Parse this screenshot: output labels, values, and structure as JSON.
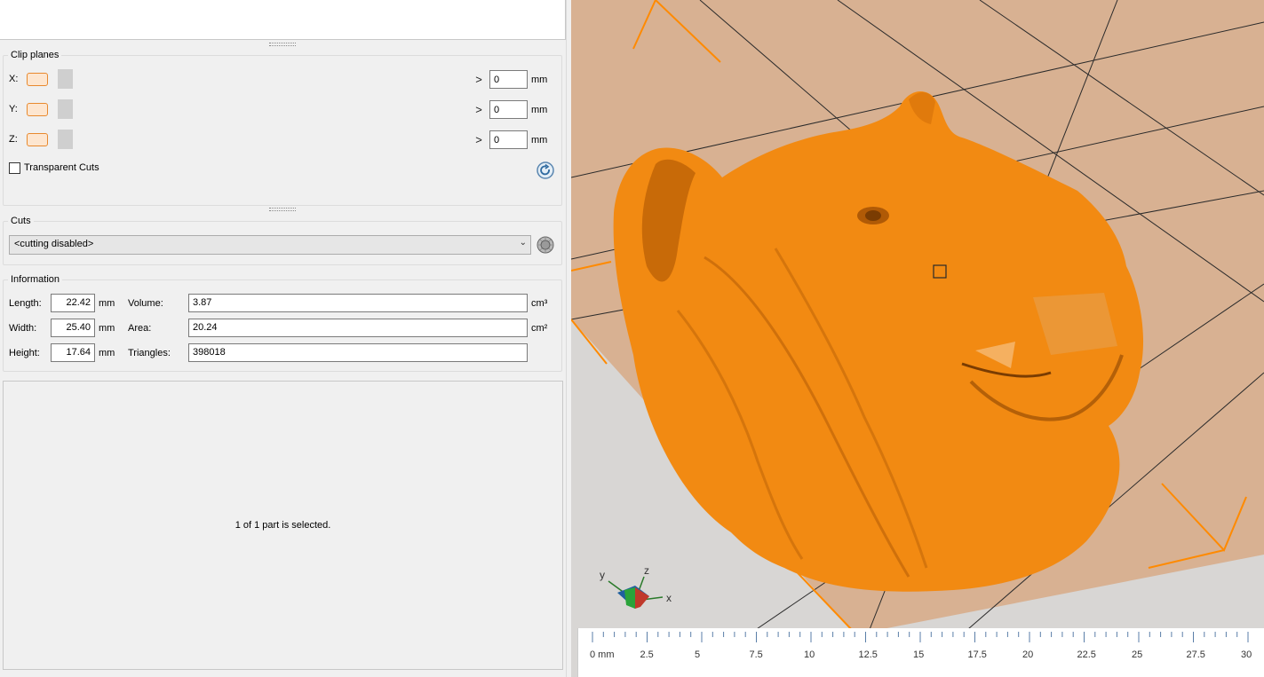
{
  "clip_planes": {
    "title": "Clip planes",
    "axes": [
      {
        "label": "X:",
        "value": "0",
        "unit": "mm"
      },
      {
        "label": "Y:",
        "value": "0",
        "unit": "mm"
      },
      {
        "label": "Z:",
        "value": "0",
        "unit": "mm"
      }
    ],
    "left_arrow": "<",
    "right_arrow": ">",
    "transparent_cuts_label": "Transparent Cuts"
  },
  "cuts": {
    "title": "Cuts",
    "selected": "<cutting disabled>"
  },
  "information": {
    "title": "Information",
    "length_label": "Length:",
    "length_value": "22.42",
    "length_unit": "mm",
    "width_label": "Width:",
    "width_value": "25.40",
    "width_unit": "mm",
    "height_label": "Height:",
    "height_value": "17.64",
    "height_unit": "mm",
    "volume_label": "Volume:",
    "volume_value": "3.87",
    "volume_unit": "cm³",
    "area_label": "Area:",
    "area_value": "20.24",
    "area_unit": "cm²",
    "triangles_label": "Triangles:",
    "triangles_value": "398018"
  },
  "status": "1 of 1 part is selected.",
  "viewport": {
    "model_color": "#f28a12",
    "plate_color": "#d8b192",
    "axis_labels": {
      "x": "x",
      "y": "y",
      "z": "z"
    }
  },
  "ruler": {
    "labels": [
      "0 mm",
      "2.5",
      "5",
      "7.5",
      "10",
      "12.5",
      "15",
      "17.5",
      "20",
      "22.5",
      "25",
      "27.5",
      "30"
    ]
  }
}
